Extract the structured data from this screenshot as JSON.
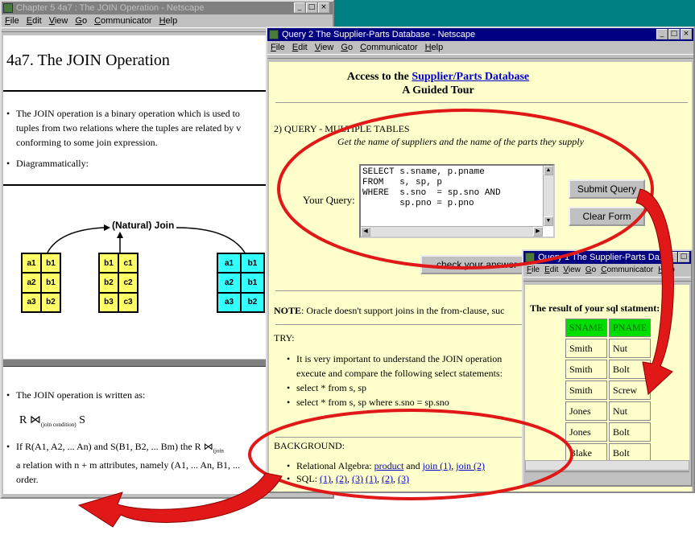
{
  "desktop_color": "#008080",
  "left_window": {
    "title": "Chapter 5 4a7 : The JOIN Operation - Netscape",
    "menu": [
      "File",
      "Edit",
      "View",
      "Go",
      "Communicator",
      "Help"
    ],
    "heading": "4a7. The JOIN Operation",
    "bullets_top": [
      "The JOIN operation is a binary operation which is used to",
      "tuples from two relations where the tuples are related by v",
      "conforming to some join expression."
    ],
    "diagram_bullet": "Diagrammatically:",
    "join_label": "(Natural)  Join",
    "rel1": [
      [
        "a1",
        "b1"
      ],
      [
        "a2",
        "b1"
      ],
      [
        "a3",
        "b2"
      ]
    ],
    "rel2": [
      [
        "b1",
        "c1"
      ],
      [
        "b2",
        "c2"
      ],
      [
        "b3",
        "c3"
      ]
    ],
    "rel3": [
      [
        "a1",
        "b1"
      ],
      [
        "a2",
        "b1"
      ],
      [
        "a3",
        "b2"
      ]
    ],
    "bottom_bullet1": "The JOIN operation is written as:",
    "notation_r": "R",
    "notation_join": "⋈",
    "notation_sub": "(join condition)",
    "notation_s": "S",
    "bottom_bullet2a": "If R(A1, A2, ... An) and S(B1, B2, ... Bm) the",
    "bottom_bullet2_r": "R",
    "bottom_bullet2_join": "⋈",
    "bottom_bullet2_sub": "(join",
    "bottom_bullet2b": "a relation with n + m attributes, namely (A1, ... An, B1, ...",
    "bottom_bullet2c": "order."
  },
  "mid_window": {
    "title": "Query 2 The Supplier-Parts Database - Netscape",
    "menu": [
      "File",
      "Edit",
      "View",
      "Go",
      "Communicator",
      "Help"
    ],
    "header_prefix": "Access to the ",
    "header_link": "Supplier/Parts Database",
    "header_line2": "A Guided Tour",
    "query_heading": "2) QUERY - MULTIPLE TABLES",
    "query_desc": "Get the name of suppliers and the name of the parts they supply",
    "your_query_label": "Your Query:",
    "sql": "SELECT s.sname, p.pname\nFROM   s, sp, p\nWHERE  s.sno  = sp.sno AND\n       sp.pno = p.pno",
    "submit_label": "Submit Query",
    "clear_label": "Clear Form",
    "check_label": "check your answer",
    "note_label": "NOTE",
    "note_text": ": Oracle doesn't support joins in the from-clause, suc",
    "try_label": "TRY:",
    "try_items": [
      "It is very important to understand the JOIN operation",
      "execute and compare the following select statements:",
      "select * from s, sp",
      "select * from s, sp where s.sno = sp.sno"
    ],
    "background_label": "BACKGROUND:",
    "bg_ra_label": "Relational Algebra: ",
    "bg_ra_links": [
      "product",
      "join (1)",
      "join (2)"
    ],
    "bg_ra_sep": [
      "and",
      ","
    ],
    "bg_sql_label": "SQL: ",
    "bg_sql_links": [
      "(1)",
      "(2)",
      "(3)",
      "(1)",
      "(2)",
      "(3)"
    ]
  },
  "result_window": {
    "title": "Query 1 The Supplier-Parts Da...",
    "menu": [
      "File",
      "Edit",
      "View",
      "Go",
      "Communicator",
      "Help"
    ],
    "heading": "The result of your sql statment:",
    "columns": [
      "SNAME",
      "PNAME"
    ],
    "rows": [
      [
        "Smith",
        "Nut"
      ],
      [
        "Smith",
        "Bolt"
      ],
      [
        "Smith",
        "Screw"
      ],
      [
        "Jones",
        "Nut"
      ],
      [
        "Jones",
        "Bolt"
      ],
      [
        "Blake",
        "Bolt"
      ]
    ]
  },
  "colors": {
    "annotation_red": "#e01818",
    "yellow_page": "#ffffcc",
    "cell_yellow": "#ffff66",
    "cell_cyan": "#33ffff",
    "header_green": "#00dd00"
  }
}
